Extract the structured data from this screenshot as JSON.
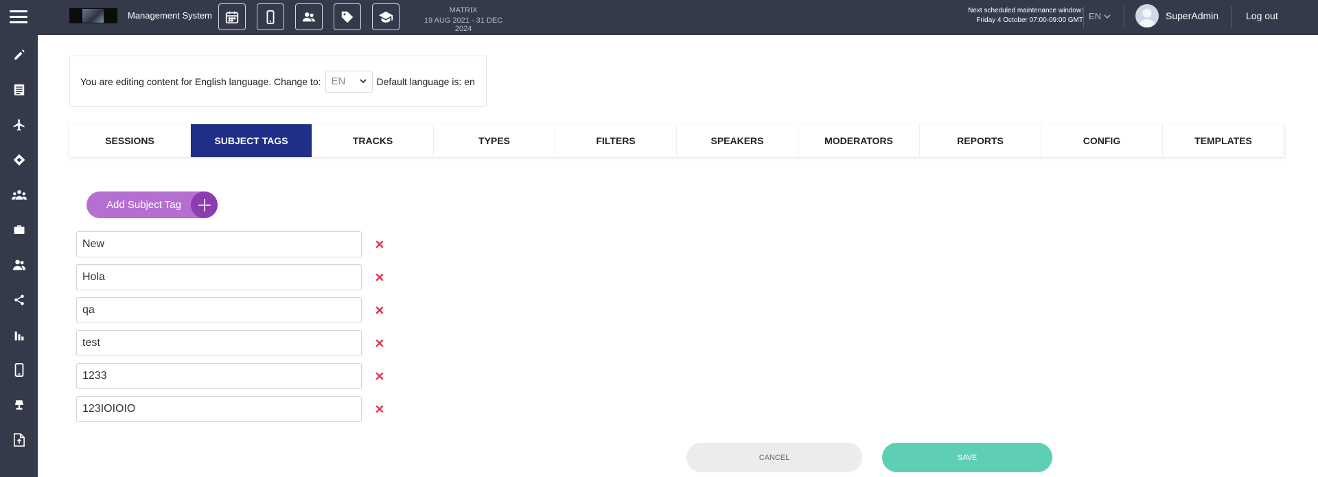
{
  "header": {
    "app_title": "Management System",
    "event_name": "MATRIX",
    "event_dates": "19 AUG 2021 - 31 DEC 2024",
    "maintenance_line1": "Next scheduled maintenance window:",
    "maintenance_line2": "Friday 4 October 07:00-09:00 GMT",
    "language": "EN",
    "username": "SuperAdmin",
    "logout_label": "Log out",
    "quick_icons": [
      "calendar-icon",
      "mobile-icon",
      "people-icon",
      "tag-icon",
      "graduation-cap-icon"
    ]
  },
  "sidebar": {
    "icons": [
      "pencil-icon",
      "list-icon",
      "airplane-icon",
      "ticket-icon",
      "groups-icon",
      "briefcase-icon",
      "users-icon",
      "share-icon",
      "bar-chart-icon",
      "mobile-icon",
      "lamp-icon",
      "upload-file-icon"
    ]
  },
  "language_notice": {
    "prefix": "You are editing content for ",
    "language_name": "English",
    "middle": " language. Change to:",
    "selected": "EN",
    "default_text": "Default language is: en"
  },
  "tabs": [
    {
      "label": "SESSIONS",
      "active": false
    },
    {
      "label": "SUBJECT TAGS",
      "active": true
    },
    {
      "label": "TRACKS",
      "active": false
    },
    {
      "label": "TYPES",
      "active": false
    },
    {
      "label": "FILTERS",
      "active": false
    },
    {
      "label": "SPEAKERS",
      "active": false
    },
    {
      "label": "MODERATORS",
      "active": false
    },
    {
      "label": "REPORTS",
      "active": false
    },
    {
      "label": "CONFIG",
      "active": false
    },
    {
      "label": "TEMPLATES",
      "active": false
    }
  ],
  "add_button_label": "Add Subject Tag",
  "tags": [
    "New",
    "Hola",
    "qa",
    "test",
    "1233",
    "123IOIOIO"
  ],
  "footer": {
    "cancel_label": "CANCEL",
    "save_label": "SAVE"
  },
  "colors": {
    "topbar": "#353a4a",
    "active_tab": "#1f2e86",
    "add_button": "#b46fd1",
    "add_button_plus": "#8b3db0",
    "delete": "#e03a5a",
    "save": "#5ecfb4",
    "cancel": "#ececec"
  }
}
